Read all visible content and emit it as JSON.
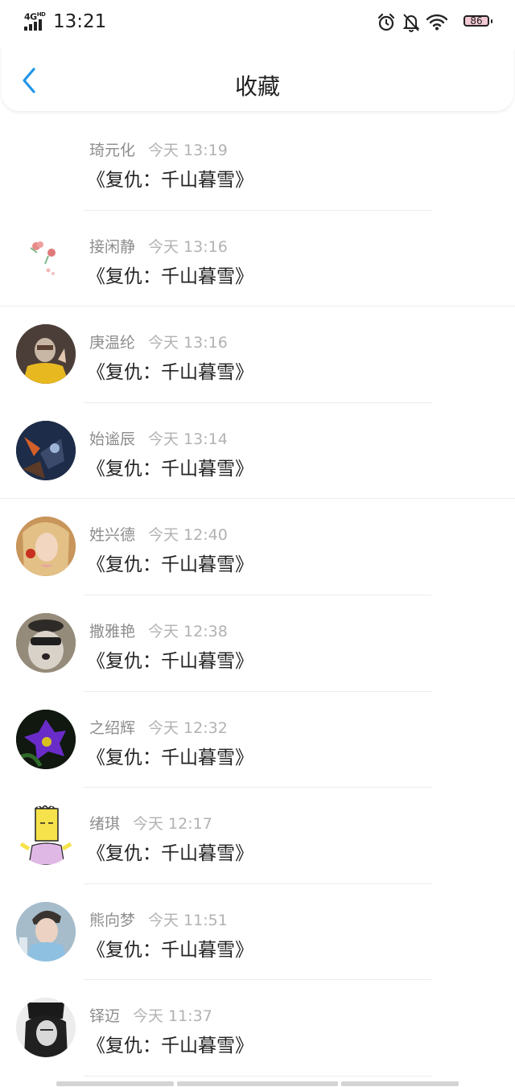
{
  "status_bar": {
    "network": "4G",
    "network_sup": "HD",
    "time": "13:21",
    "battery": "86",
    "icons": [
      "alarm-icon",
      "bell-off-icon",
      "wifi-icon",
      "battery-icon"
    ]
  },
  "nav": {
    "back_icon": "chevron-left-icon",
    "title": "收藏",
    "accent_color": "#2196e8"
  },
  "favorites": [
    {
      "name": "琦元化",
      "time": "今天 13:19",
      "subject": "《复仇：千山暮雪》",
      "avatar": "blank"
    },
    {
      "name": "接闲静",
      "time": "今天 13:16",
      "subject": "《复仇：千山暮雪》",
      "avatar": "flower"
    },
    {
      "name": "庚温纶",
      "time": "今天 13:16",
      "subject": "《复仇：千山暮雪》",
      "avatar": "masked-person"
    },
    {
      "name": "始谧辰",
      "time": "今天 13:14",
      "subject": "《复仇：千山暮雪》",
      "avatar": "fantasy-art"
    },
    {
      "name": "姓兴德",
      "time": "今天 12:40",
      "subject": "《复仇：千山暮雪》",
      "avatar": "woman-portrait"
    },
    {
      "name": "撒雅艳",
      "time": "今天 12:38",
      "subject": "《复仇：千山暮雪》",
      "avatar": "dog-with-hat"
    },
    {
      "name": "之绍辉",
      "time": "今天 12:32",
      "subject": "《复仇：千山暮雪》",
      "avatar": "purple-flower"
    },
    {
      "name": "绪琪",
      "time": "今天 12:17",
      "subject": "《复仇：千山暮雪》",
      "avatar": "cartoon-character"
    },
    {
      "name": "熊向梦",
      "time": "今天 11:51",
      "subject": "《复仇：千山暮雪》",
      "avatar": "man-portrait"
    },
    {
      "name": "铎迈",
      "time": "今天 11:37",
      "subject": "《复仇：千山暮雪》",
      "avatar": "bw-portrait"
    }
  ]
}
